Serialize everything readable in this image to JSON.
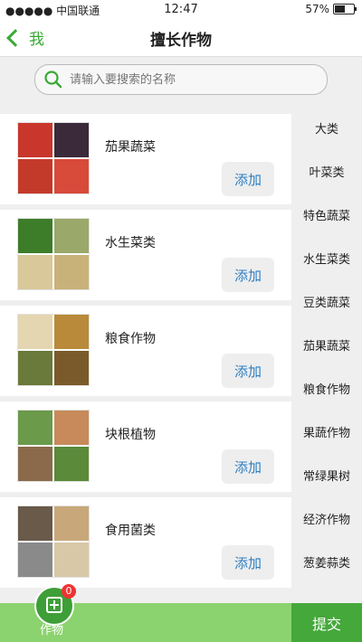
{
  "status_bar": {
    "carrier": "●●●●● 中国联通",
    "time": "12:47",
    "battery": "57%"
  },
  "nav": {
    "back_label": "我",
    "title": "擅长作物"
  },
  "search": {
    "placeholder": "请输入要搜索的名称"
  },
  "items": [
    {
      "name": "茄果蔬菜",
      "add_label": "添加",
      "thumb_colors": [
        "#c9362b",
        "#3a2a3a",
        "#c43a2a",
        "#d84a3a"
      ]
    },
    {
      "name": "水生菜类",
      "add_label": "添加",
      "thumb_colors": [
        "#3d7d2a",
        "#9aa86a",
        "#d8c89a",
        "#c9b27a"
      ]
    },
    {
      "name": "粮食作物",
      "add_label": "添加",
      "thumb_colors": [
        "#e3d6b0",
        "#b88a3a",
        "#6a7a3a",
        "#7a5a2a"
      ]
    },
    {
      "name": "块根植物",
      "add_label": "添加",
      "thumb_colors": [
        "#6a9a4a",
        "#c88a5a",
        "#8a6a4a",
        "#5a8a3a"
      ]
    },
    {
      "name": "食用菌类",
      "add_label": "添加",
      "thumb_colors": [
        "#6a5a4a",
        "#c8a87a",
        "#8a8a8a",
        "#d8c8a8"
      ]
    }
  ],
  "categories": [
    "大类",
    "叶菜类",
    "特色蔬菜",
    "水生菜类",
    "豆类蔬菜",
    "茄果蔬菜",
    "粮食作物",
    "果蔬作物",
    "常绿果树",
    "经济作物",
    "葱姜蒜类"
  ],
  "footer": {
    "crop_label": "作物",
    "badge_count": "0",
    "submit_label": "提交"
  },
  "colors": {
    "accent": "#3aa935",
    "submit": "#45a83b",
    "footer_bar": "#8bd36e",
    "add_text": "#2f7fc1"
  }
}
